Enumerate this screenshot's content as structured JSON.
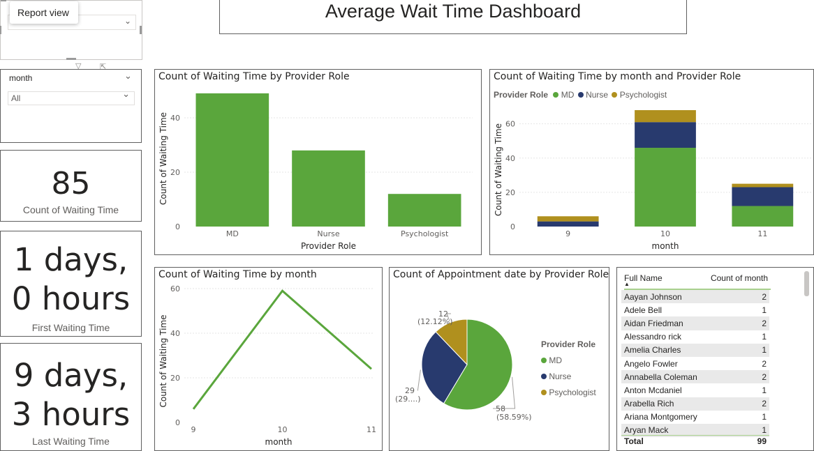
{
  "tooltip": {
    "label": "Report view"
  },
  "header": {
    "title": "Average Wait Time Dashboard"
  },
  "slicer": {
    "title": "month",
    "selected": "All"
  },
  "kpis": [
    {
      "value": "85",
      "label": "Count of Waiting Time"
    },
    {
      "value_line1": "1 days,",
      "value_line2": "0 hours",
      "label": "First Waiting Time"
    },
    {
      "value_line1": "9 days,",
      "value_line2": "3 hours",
      "label": "Last Waiting Time"
    }
  ],
  "chart_data": [
    {
      "type": "bar",
      "title": "Count of Waiting Time by Provider Role",
      "xlabel": "Provider Role",
      "ylabel": "Count of Waiting Time",
      "categories": [
        "MD",
        "Nurse",
        "Psychologist"
      ],
      "values": [
        49,
        28,
        12
      ],
      "yticks": [
        0,
        20,
        40
      ],
      "ylim": [
        0,
        50
      ],
      "grid": true,
      "color": "#5aa63c"
    },
    {
      "type": "bar",
      "stacked": true,
      "title": "Count of Waiting Time by month and Provider Role",
      "legend_title": "Provider Role",
      "xlabel": "month",
      "ylabel": "Count of Waiting Time",
      "categories": [
        "9",
        "10",
        "11"
      ],
      "series": [
        {
          "name": "MD",
          "color": "#5aa63c",
          "values": [
            0,
            46,
            12
          ]
        },
        {
          "name": "Nurse",
          "color": "#283a6e",
          "values": [
            3,
            15,
            11
          ]
        },
        {
          "name": "Psychologist",
          "color": "#b0901e",
          "values": [
            3,
            7,
            2
          ]
        }
      ],
      "yticks": [
        0,
        20,
        40,
        60
      ],
      "ylim": [
        0,
        68
      ],
      "grid": true,
      "legend_position": "top-left"
    },
    {
      "type": "line",
      "title": "Count of Waiting Time by month",
      "xlabel": "month",
      "ylabel": "Count of Waiting Time",
      "x": [
        "9",
        "10",
        "11"
      ],
      "values": [
        6,
        59,
        24
      ],
      "yticks": [
        0,
        20,
        40,
        60
      ],
      "ylim": [
        0,
        60
      ],
      "grid": true,
      "color": "#5aa63c"
    },
    {
      "type": "pie",
      "title": "Count of Appointment date by Provider Role",
      "legend_title": "Provider Role",
      "legend_position": "right",
      "slices": [
        {
          "name": "MD",
          "value": 58,
          "label_count": "58",
          "label_pct": "(58.59%)",
          "color": "#5aa63c"
        },
        {
          "name": "Nurse",
          "value": 29,
          "label_count": "29",
          "label_pct": "(29....)",
          "color": "#283a6e"
        },
        {
          "name": "Psychologist",
          "value": 12,
          "label_count": "12",
          "label_pct": "(12.12%)",
          "color": "#b0901e"
        }
      ]
    }
  ],
  "table": {
    "headers": [
      "Full Name",
      "Count of month"
    ],
    "rows": [
      {
        "name": "Aayan Johnson",
        "count": "2"
      },
      {
        "name": "Adele Bell",
        "count": "1"
      },
      {
        "name": "Aidan Friedman",
        "count": "2"
      },
      {
        "name": "Alessandro rick",
        "count": "1"
      },
      {
        "name": "Amelia Charles",
        "count": "1"
      },
      {
        "name": "Angelo Fowler",
        "count": "2"
      },
      {
        "name": "Annabella Coleman",
        "count": "2"
      },
      {
        "name": "Anton Mcdaniel",
        "count": "1"
      },
      {
        "name": "Arabella Rich",
        "count": "2"
      },
      {
        "name": "Ariana Montgomery",
        "count": "1"
      },
      {
        "name": "Aryan Mack",
        "count": "1"
      }
    ],
    "total_label": "Total",
    "total_value": "99"
  }
}
